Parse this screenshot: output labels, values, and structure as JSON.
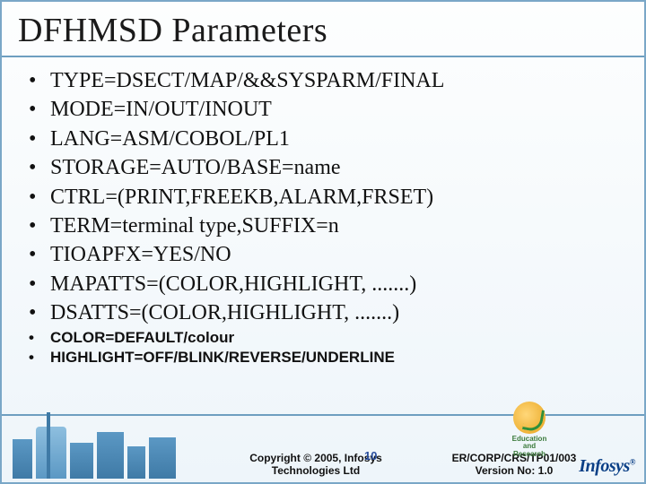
{
  "title": "DFHMSD Parameters",
  "bullets": [
    "TYPE=DSECT/MAP/&&SYSPARM/FINAL",
    "MODE=IN/OUT/INOUT",
    "LANG=ASM/COBOL/PL1",
    "STORAGE=AUTO/BASE=name",
    "CTRL=(PRINT,FREEKB,ALARM,FRSET)",
    "TERM=terminal type,SUFFIX=n",
    "TIOAPFX=YES/NO",
    "MAPATTS=(COLOR,HIGHLIGHT, .......)",
    "DSATTS=(COLOR,HIGHLIGHT, .......)"
  ],
  "subbullets": [
    "COLOR=DEFAULT/colour",
    "HIGHLIGHT=OFF/BLINK/REVERSE/UNDERLINE"
  ],
  "footer": {
    "copyright_line1": "Copyright © 2005, Infosys",
    "copyright_line2": "Technologies Ltd",
    "page_number": "10",
    "ref_line1": "ER/CORP/CRS/TP01/003",
    "ref_line2": "Version No: 1.0",
    "edu_line1": "Education",
    "edu_line2": "and",
    "edu_line3": "Research",
    "brand": "Infosys",
    "brand_reg": "®"
  }
}
